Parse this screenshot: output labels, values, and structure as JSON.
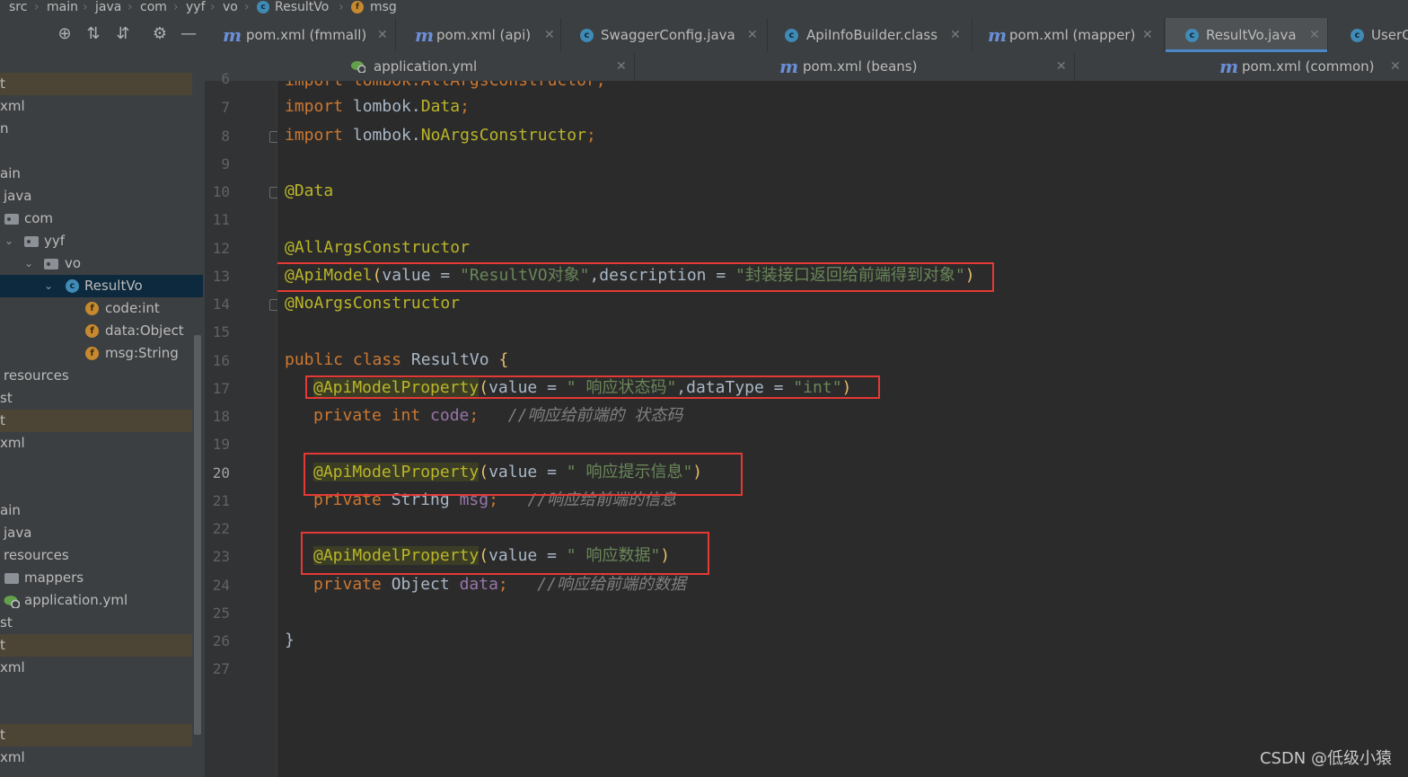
{
  "breadcrumb": {
    "items": [
      "src",
      "main",
      "java",
      "com",
      "yyf",
      "vo",
      "ResultVo",
      "msg"
    ],
    "separator": "›"
  },
  "tabs": [
    {
      "label": "pom.xml (fmmall)",
      "icon": "maven-icon"
    },
    {
      "label": "pom.xml (api)",
      "icon": "maven-icon"
    },
    {
      "label": "SwaggerConfig.java",
      "icon": "class-icon"
    },
    {
      "label": "ApiInfoBuilder.class",
      "icon": "class-icon"
    },
    {
      "label": "pom.xml (mapper)",
      "icon": "maven-icon"
    },
    {
      "label": "ResultVo.java",
      "icon": "class-icon",
      "active": true
    },
    {
      "label": "UserC",
      "icon": "class-icon"
    }
  ],
  "tabs2": [
    {
      "label": "application.yml",
      "icon": "spring-yaml-icon"
    },
    {
      "label": "pom.xml (beans)",
      "icon": "maven-icon"
    },
    {
      "label": "pom.xml (common)",
      "icon": "maven-icon"
    }
  ],
  "tree": {
    "rows": [
      {
        "label": "t"
      },
      {
        "label": "xml"
      },
      {
        "label": "n"
      },
      {
        "label": ""
      },
      {
        "label": "ain"
      },
      {
        "label": "java"
      },
      {
        "label": "com"
      },
      {
        "label": "yyf"
      },
      {
        "label": "vo"
      },
      {
        "label": "ResultVo"
      },
      {
        "label": "code:int"
      },
      {
        "label": "data:Object"
      },
      {
        "label": "msg:String"
      },
      {
        "label": "resources"
      },
      {
        "label": "st"
      },
      {
        "label": "t"
      },
      {
        "label": "xml"
      },
      {
        "label": ""
      },
      {
        "label": ""
      },
      {
        "label": "ain"
      },
      {
        "label": "java"
      },
      {
        "label": "resources"
      },
      {
        "label": "mappers"
      },
      {
        "label": "application.yml"
      },
      {
        "label": "st"
      },
      {
        "label": "t"
      },
      {
        "label": "xml"
      },
      {
        "label": ""
      },
      {
        "label": ""
      },
      {
        "label": "t"
      },
      {
        "label": "xml"
      }
    ]
  },
  "editor": {
    "line_numbers": [
      "7",
      "8",
      "9",
      "10",
      "11",
      "12",
      "13",
      "14",
      "15",
      "16",
      "17",
      "18",
      "19",
      "20",
      "21",
      "22",
      "23",
      "24",
      "25",
      "26",
      "27"
    ],
    "current_line": "20",
    "partial_top_line": "import lombok.AllArgsConstructor;",
    "line7": {
      "kw": "import",
      "rest": " lombok.",
      "cls": "Data",
      "end": ";"
    },
    "line8": {
      "kw": "import",
      "rest": " lombok.",
      "cls": "NoArgsConstructor",
      "end": ";"
    },
    "line10": "@Data",
    "line12": "@AllArgsConstructor",
    "line13": {
      "ann": "@ApiModel",
      "open": "(",
      "p1": "value = ",
      "s1": "\"ResultVO对象\"",
      "p2": ",description = ",
      "s2": "\"封装接口返回给前端得到对象\"",
      "close": ")"
    },
    "line14": "@NoArgsConstructor",
    "line16": {
      "kw": "public class ",
      "name": "ResultVo ",
      "brace": "{"
    },
    "line17": {
      "ann": "@ApiModelProperty",
      "open": "(",
      "p1": "value = ",
      "s1": "\" 响应状态码\"",
      "p2": ",dataType = ",
      "s2": "\"int\"",
      "close": ")"
    },
    "line18": {
      "kw": "private int ",
      "fld": "code",
      "end": ";",
      "cm": "//响应给前端的 状态码"
    },
    "line20": {
      "ann": "@ApiModelProperty",
      "open": "(",
      "p1": "value = ",
      "s1": "\" 响应提示信息\"",
      "close": ")"
    },
    "line21": {
      "kw": "private ",
      "type": "String ",
      "fld": "msg",
      "end": ";",
      "cm": "//响应给前端的信息"
    },
    "line23": {
      "ann": "@ApiModelProperty",
      "open": "(",
      "p1": "value = ",
      "s1": "\" 响应数据\"",
      "close": ")"
    },
    "line24": {
      "kw": "private ",
      "type": "Object ",
      "fld": "data",
      "end": ";",
      "cm": "//响应给前端的数据"
    },
    "line26": "}"
  },
  "watermark": "CSDN @低级小猿",
  "colors": {
    "keyword": "#cc7832",
    "annotation": "#bbb529",
    "string": "#6a8759",
    "field": "#9876aa",
    "comment": "#808080",
    "highlight_box": "#e53935"
  }
}
